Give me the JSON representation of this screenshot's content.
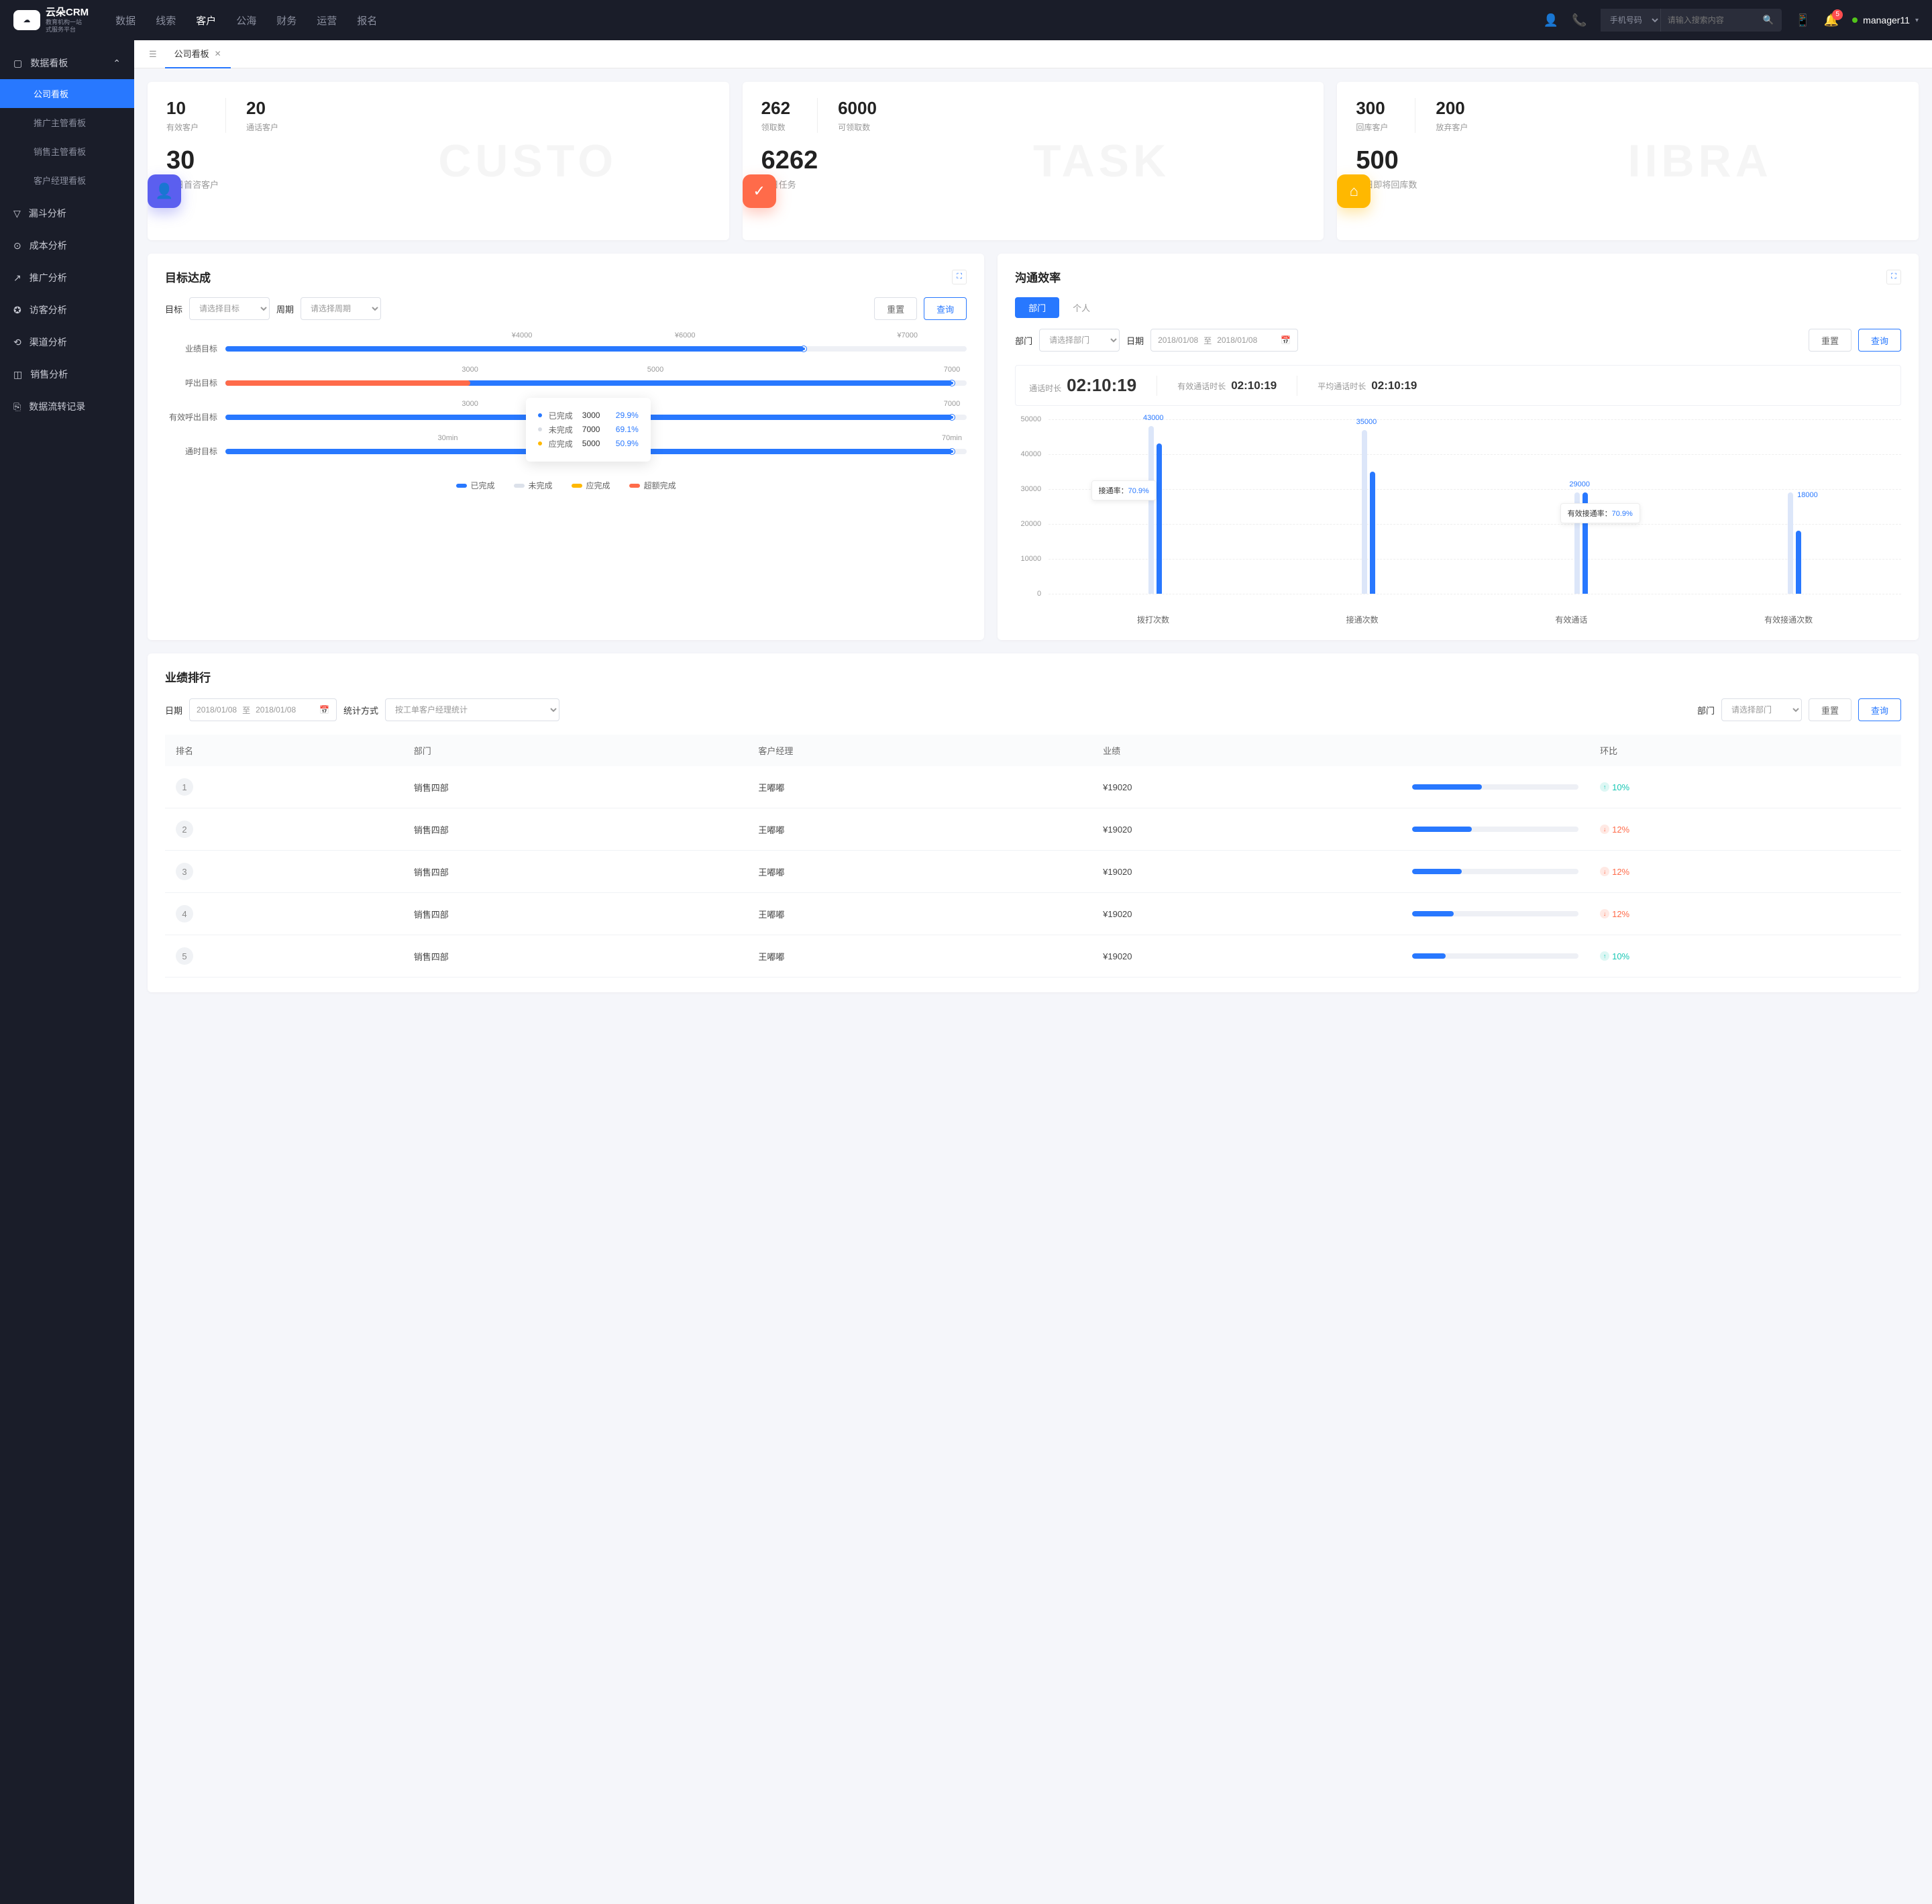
{
  "header": {
    "logo_title": "云朵CRM",
    "logo_sub1": "教育机构一站",
    "logo_sub2": "式服务平台",
    "nav": [
      "数据",
      "线索",
      "客户",
      "公海",
      "财务",
      "运营",
      "报名"
    ],
    "nav_active": 2,
    "search_type": "手机号码",
    "search_placeholder": "请输入搜索内容",
    "notif_count": "5",
    "user": "manager11"
  },
  "sidebar": {
    "group0": {
      "title": "数据看板",
      "items": [
        "公司看板",
        "推广主管看板",
        "销售主管看板",
        "客户经理看板"
      ],
      "active": 0
    },
    "items": [
      "漏斗分析",
      "成本分析",
      "推广分析",
      "访客分析",
      "渠道分析",
      "销售分析",
      "数据流转记录"
    ]
  },
  "tab": {
    "label": "公司看板"
  },
  "stats": [
    {
      "a_num": "10",
      "a_lbl": "有效客户",
      "b_num": "20",
      "b_lbl": "通话客户",
      "big": "30",
      "big_lbl": "今日首咨客户",
      "wm": "CUSTO"
    },
    {
      "a_num": "262",
      "a_lbl": "领取数",
      "b_num": "6000",
      "b_lbl": "可领取数",
      "big": "6262",
      "big_lbl": "今日任务",
      "wm": "TASK"
    },
    {
      "a_num": "300",
      "a_lbl": "回库客户",
      "b_num": "200",
      "b_lbl": "放弃客户",
      "big": "500",
      "big_lbl": "今日即将回库数",
      "wm": "IIBRA"
    }
  ],
  "goals": {
    "title": "目标达成",
    "f_target": "目标",
    "f_target_ph": "请选择目标",
    "f_period": "周期",
    "f_period_ph": "请选择周期",
    "btn_reset": "重置",
    "btn_query": "查询",
    "rows": [
      {
        "label": "业绩目标",
        "ticks": [
          "¥4000",
          "¥6000",
          "¥7000"
        ],
        "tick_pos": [
          40,
          62,
          92
        ],
        "blue": 78
      },
      {
        "label": "呼出目标",
        "ticks": [
          "3000",
          "5000",
          "7000"
        ],
        "tick_pos": [
          33,
          58,
          98
        ],
        "blue": 98,
        "orange": 33
      },
      {
        "label": "有效呼出目标",
        "ticks": [
          "3000",
          "7000"
        ],
        "tick_pos": [
          33,
          98
        ],
        "blue": 98,
        "light": 60
      },
      {
        "label": "通时目标",
        "ticks": [
          "30min",
          "70min"
        ],
        "tick_pos": [
          30,
          98
        ],
        "blue": 98
      }
    ],
    "tooltip": {
      "rows": [
        {
          "color": "#2878ff",
          "label": "已完成",
          "val": "3000",
          "pct": "29.9%"
        },
        {
          "color": "#d8dce4",
          "label": "未完成",
          "val": "7000",
          "pct": "69.1%"
        },
        {
          "color": "#ffb800",
          "label": "应完成",
          "val": "5000",
          "pct": "50.9%"
        }
      ]
    },
    "legend": [
      {
        "c": "#2878ff",
        "t": "已完成"
      },
      {
        "c": "#dce1ea",
        "t": "未完成"
      },
      {
        "c": "#ffb800",
        "t": "应完成"
      },
      {
        "c": "#ff6b4a",
        "t": "超额完成"
      }
    ]
  },
  "comm": {
    "title": "沟通效率",
    "seg": [
      "部门",
      "个人"
    ],
    "seg_active": 0,
    "f_dept": "部门",
    "f_dept_ph": "请选择部门",
    "f_date": "日期",
    "date1": "2018/01/08",
    "date_sep": "至",
    "date2": "2018/01/08",
    "btn_reset": "重置",
    "btn_query": "查询",
    "info": [
      {
        "label": "通话时长",
        "value": "02:10:19",
        "big": true
      },
      {
        "label": "有效通话时长",
        "value": "02:10:19"
      },
      {
        "label": "平均通话时长",
        "value": "02:10:19"
      }
    ],
    "y_ticks": [
      "0",
      "10000",
      "20000",
      "30000",
      "40000",
      "50000"
    ],
    "bars": [
      {
        "label": "拨打次数",
        "bg": 48000,
        "fg": 43000,
        "val": "43000"
      },
      {
        "label": "接通次数",
        "bg": 47000,
        "fg": 35000,
        "val": "35000"
      },
      {
        "label": "有效通话",
        "bg": 29000,
        "fg": 29000,
        "val": "29000"
      },
      {
        "label": "有效接通次数",
        "bg": 29000,
        "fg": 18000,
        "val": "18000"
      }
    ],
    "callouts": [
      {
        "label": "接通率：",
        "pct": "70.9%"
      },
      {
        "label": "有效接通率：",
        "pct": "70.9%"
      }
    ]
  },
  "rank": {
    "title": "业绩排行",
    "f_date": "日期",
    "date1": "2018/01/08",
    "date_sep": "至",
    "date2": "2018/01/08",
    "f_stat": "统计方式",
    "stat_val": "按工单客户经理统计",
    "f_dept": "部门",
    "f_dept_ph": "请选择部门",
    "btn_reset": "重置",
    "btn_query": "查询",
    "cols": [
      "排名",
      "部门",
      "客户经理",
      "业绩",
      "",
      "环比"
    ],
    "rows": [
      {
        "rank": "1",
        "dept": "销售四部",
        "mgr": "王嘟嘟",
        "perf": "¥19020",
        "bar": 42,
        "chg": "10%",
        "dir": "up"
      },
      {
        "rank": "2",
        "dept": "销售四部",
        "mgr": "王嘟嘟",
        "perf": "¥19020",
        "bar": 36,
        "chg": "12%",
        "dir": "down"
      },
      {
        "rank": "3",
        "dept": "销售四部",
        "mgr": "王嘟嘟",
        "perf": "¥19020",
        "bar": 30,
        "chg": "12%",
        "dir": "down"
      },
      {
        "rank": "4",
        "dept": "销售四部",
        "mgr": "王嘟嘟",
        "perf": "¥19020",
        "bar": 25,
        "chg": "12%",
        "dir": "down"
      },
      {
        "rank": "5",
        "dept": "销售四部",
        "mgr": "王嘟嘟",
        "perf": "¥19020",
        "bar": 20,
        "chg": "10%",
        "dir": "up"
      }
    ]
  },
  "chart_data": [
    {
      "type": "bar",
      "title": "目标达成",
      "orientation": "horizontal",
      "categories": [
        "业绩目标",
        "呼出目标",
        "有效呼出目标",
        "通时目标"
      ],
      "series": [
        {
          "name": "已完成",
          "values": [
            5500,
            7000,
            7000,
            70
          ]
        },
        {
          "name": "未完成",
          "values": [
            7000,
            7000,
            7000,
            70
          ]
        },
        {
          "name": "应完成",
          "values": [
            5000,
            5000,
            5000,
            50
          ]
        },
        {
          "name": "超额完成",
          "values": [
            0,
            3000,
            0,
            0
          ]
        }
      ],
      "units": [
        "¥",
        "",
        "",
        "min"
      ]
    },
    {
      "type": "bar",
      "title": "沟通效率",
      "categories": [
        "拨打次数",
        "接通次数",
        "有效通话",
        "有效接通次数"
      ],
      "series": [
        {
          "name": "background",
          "values": [
            48000,
            47000,
            29000,
            29000
          ]
        },
        {
          "name": "value",
          "values": [
            43000,
            35000,
            29000,
            18000
          ]
        }
      ],
      "ylim": [
        0,
        50000
      ],
      "annotations": [
        {
          "text": "接通率：70.9%"
        },
        {
          "text": "有效接通率：70.9%"
        }
      ]
    }
  ]
}
